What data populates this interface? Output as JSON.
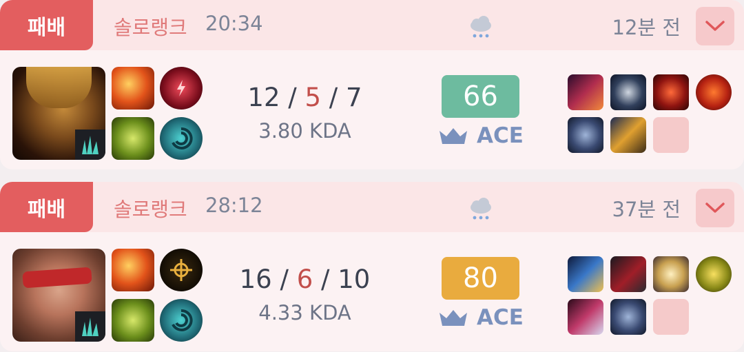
{
  "matches": [
    {
      "result": "패배",
      "queue": "솔로랭크",
      "duration": "20:34",
      "weather_icon": "rain-cloud-icon",
      "time_ago": "12분 전",
      "champion": "Jarvan IV",
      "lane_icon": "jungle-icon",
      "kills": "12",
      "deaths": "5",
      "assists": "7",
      "kda_ratio": "3.80 KDA",
      "score": "66",
      "score_color": "#6dbb9f",
      "ace_label": "ACE",
      "items_row1": [
        "sword-item-icon",
        "dark-armor-item-icon",
        "red-spike-item-icon",
        "red-helm-item-icon"
      ],
      "items_row2": [
        "boots-item-icon",
        "trinket-item-icon",
        "empty-item-slot"
      ]
    },
    {
      "result": "패배",
      "queue": "솔로랭크",
      "duration": "28:12",
      "weather_icon": "rain-cloud-icon",
      "time_ago": "37분 전",
      "champion": "Lee Sin",
      "lane_icon": "jungle-icon",
      "kills": "16",
      "deaths": "6",
      "assists": "10",
      "kda_ratio": "4.33 KDA",
      "score": "80",
      "score_color": "#e9ab3e",
      "ace_label": "ACE",
      "items_row1": [
        "blue-sword-item-icon",
        "red-black-armor-item-icon",
        "winged-item-icon",
        "gold-orb-item-icon"
      ],
      "items_row2": [
        "spear-item-icon",
        "boots-item-icon",
        "empty-item-slot"
      ]
    }
  ],
  "colors": {
    "loss_badge": "#e35e5f",
    "header_bg": "#fbe6e7",
    "card_bg": "#fcf2f3",
    "deaths": "#c24f4b",
    "ace": "#7a91bd"
  }
}
